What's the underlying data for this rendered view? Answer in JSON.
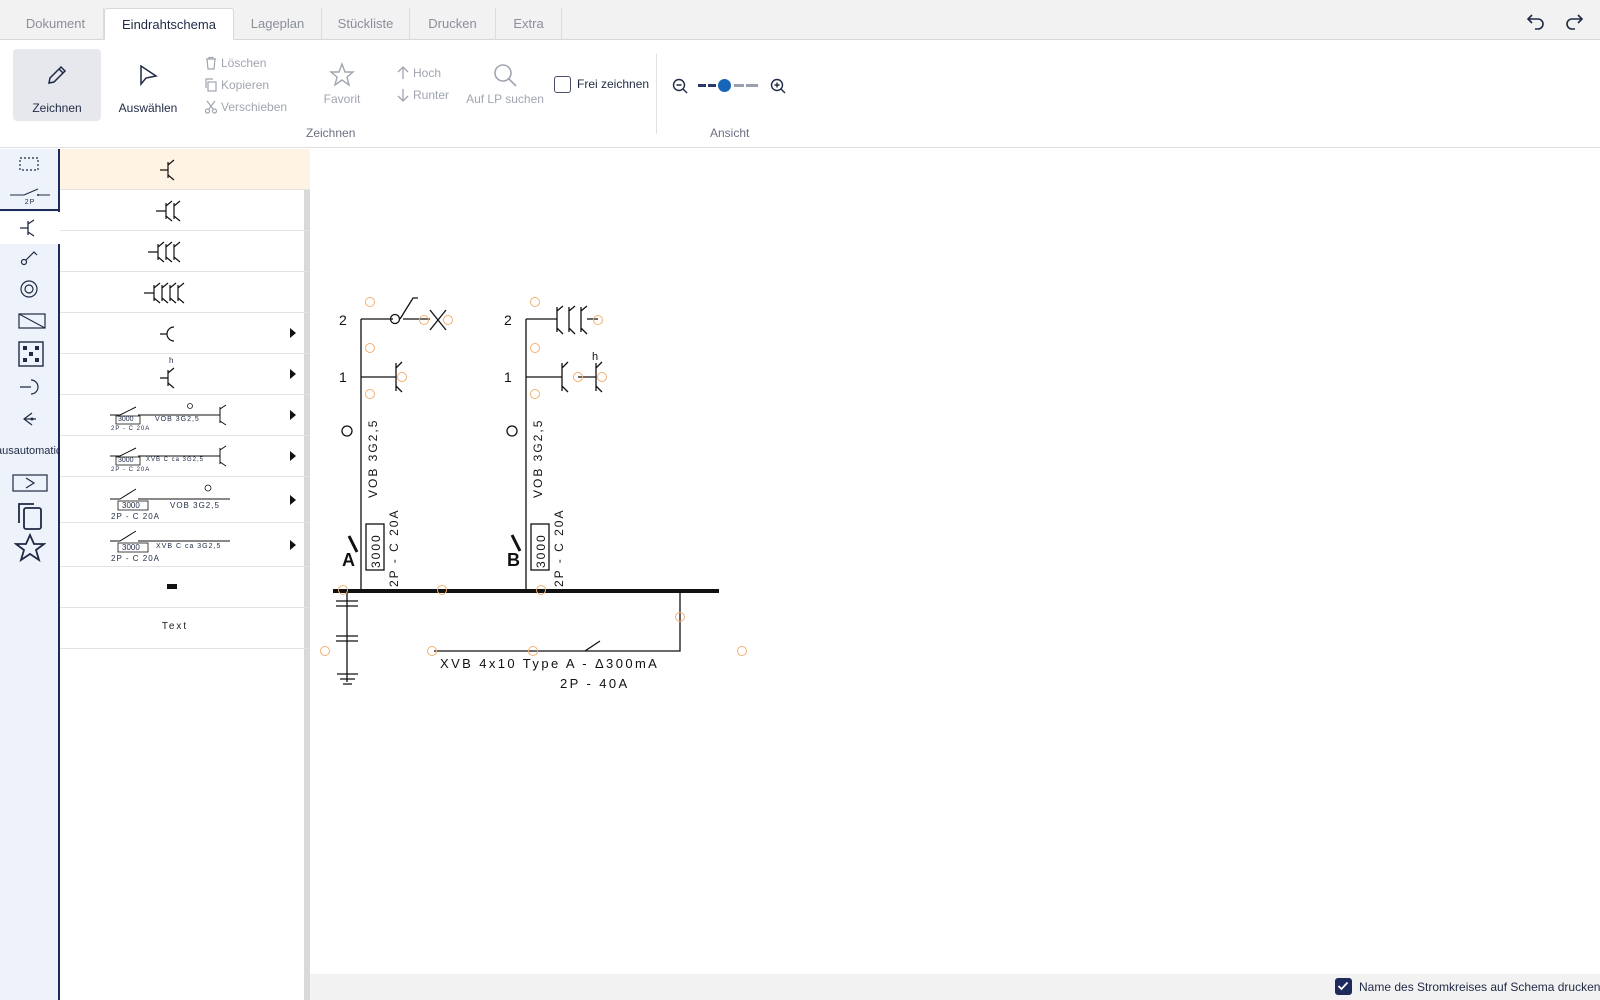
{
  "tabs": [
    {
      "label": "Dokument"
    },
    {
      "label": "Eindrahtschema"
    },
    {
      "label": "Lageplan"
    },
    {
      "label": "Stückliste"
    },
    {
      "label": "Drucken"
    },
    {
      "label": "Extra"
    }
  ],
  "active_tab": "Eindrahtschema",
  "ribbon": {
    "draw_label": "Zeichnen",
    "select_label": "Auswählen",
    "delete_label": "Löschen",
    "copy_label": "Kopieren",
    "move_label": "Verschieben",
    "favorite_label": "Favorit",
    "up_label": "Hoch",
    "down_label": "Runter",
    "search_label": "Auf LP suchen",
    "free_draw_label": "Frei zeichnen",
    "free_draw_checked": false,
    "group_draw_label": "Zeichnen",
    "group_view_label": "Ansicht",
    "zoom_level_fraction": 0.5
  },
  "sidebar": {
    "automation_label": "ausautomatic",
    "two_pole_label": "2P"
  },
  "symbol_list": {
    "row_vob_text": "VOB 3G2,5",
    "row_xvb_text": "XVB C ca 3G2,5",
    "row_code": "3000",
    "row_breaker": "2P - C 20A",
    "row_h": "h",
    "text_item": "Text"
  },
  "schema": {
    "circuit_a": {
      "label": "A",
      "code": "3000",
      "cable": "VOB 3G2,5",
      "breaker": "2P - C 20A",
      "row1": "1",
      "row2": "2"
    },
    "circuit_b": {
      "label": "B",
      "code": "3000",
      "cable": "VOB 3G2,5",
      "breaker": "2P - C 20A",
      "row1": "1",
      "row2": "2",
      "h": "h"
    },
    "main": {
      "cable": "XVB 4x10 Type A - Δ300mA",
      "breaker": "2P - 40A"
    }
  },
  "status": {
    "print_name_label": "Name des Stromkreises auf Schema drucken",
    "print_name_checked": true
  },
  "colors": {
    "accent": "#1f2a5c",
    "highlight_row": "#fff3e4",
    "handle": "#f0b070"
  }
}
